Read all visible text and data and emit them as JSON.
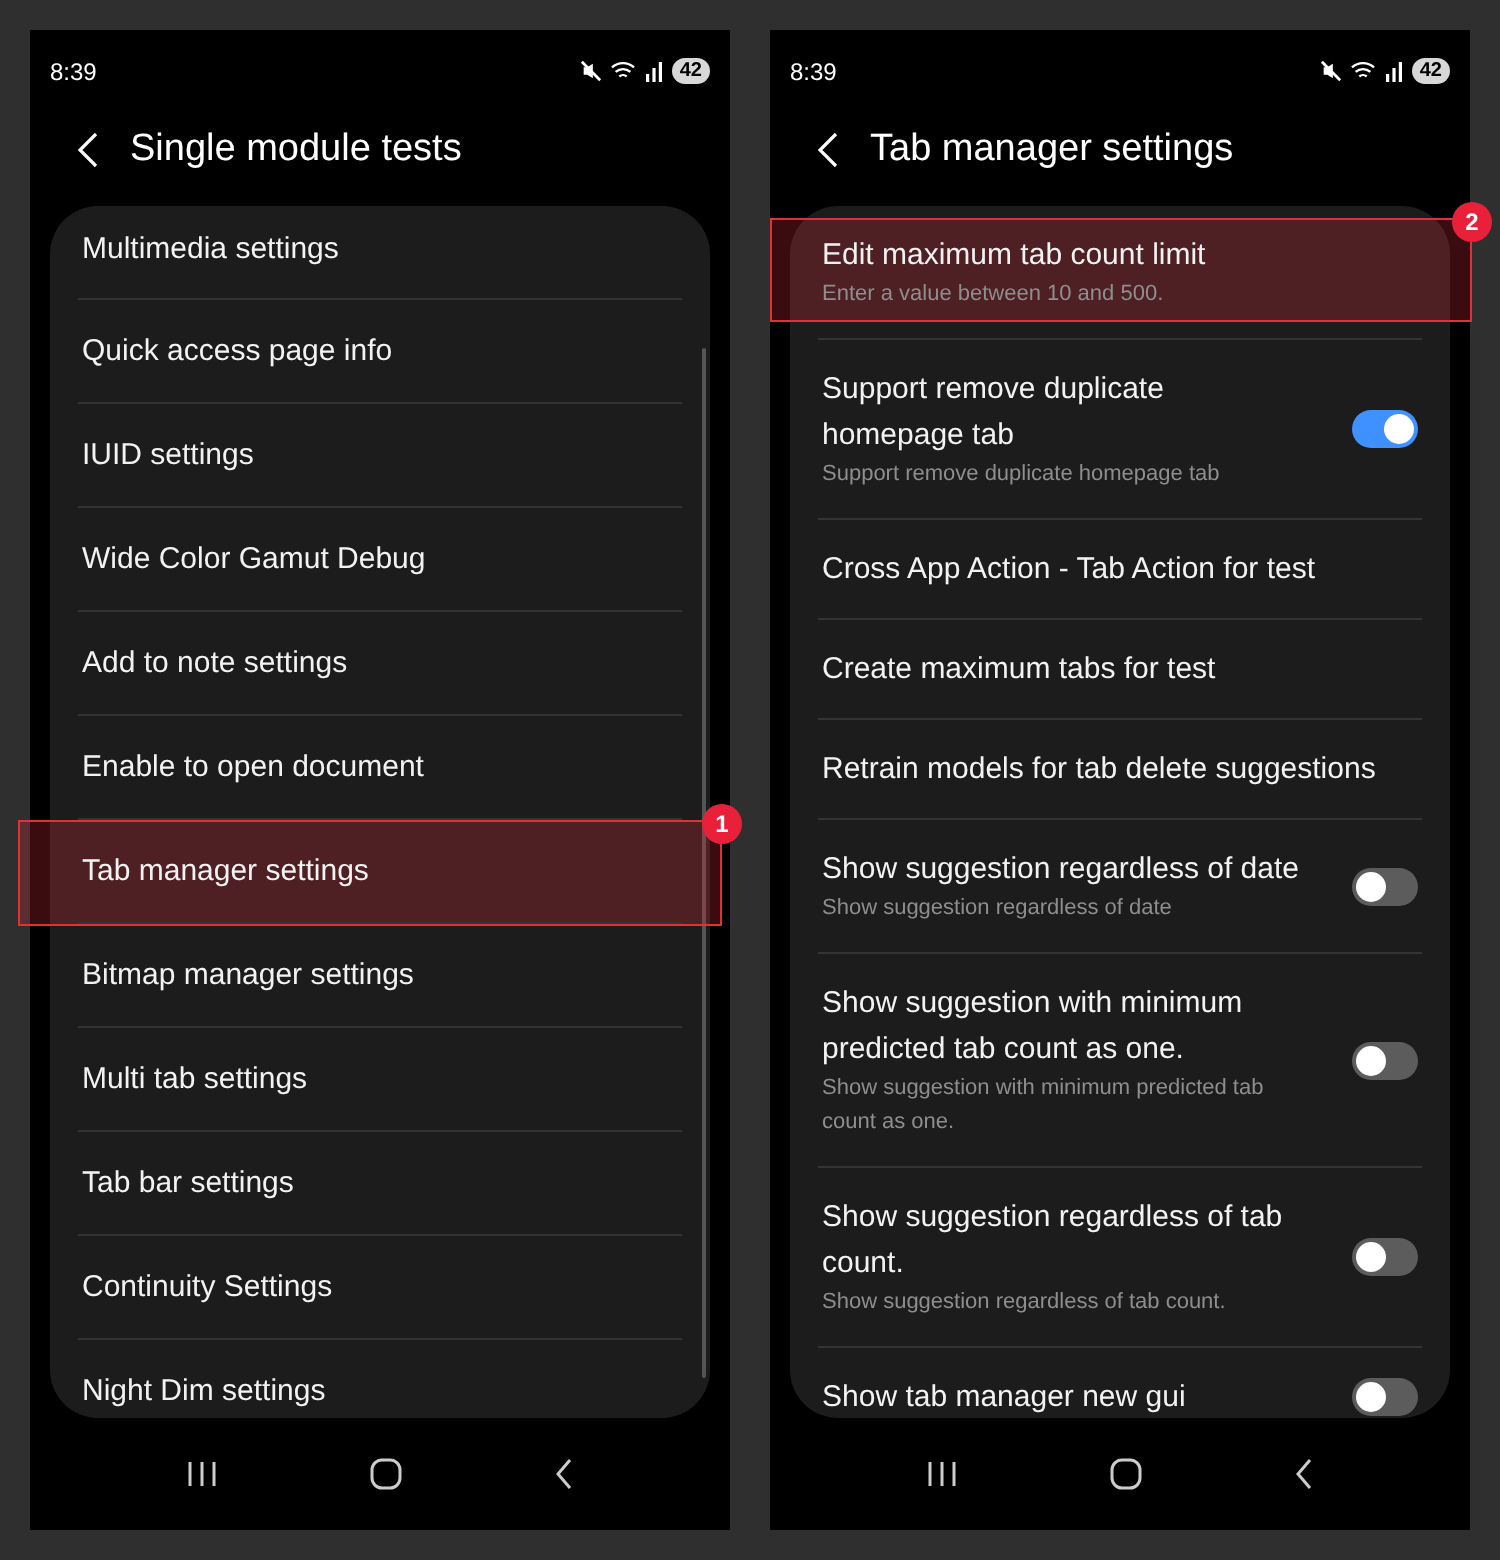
{
  "screens": [
    {
      "status_bar": {
        "time": "8:39",
        "battery": "42"
      },
      "title": "Single module tests",
      "items": [
        {
          "kind": "link",
          "title": "Multimedia settings",
          "highlighted": false
        },
        {
          "kind": "link",
          "title": "Quick access page info",
          "highlighted": false
        },
        {
          "kind": "link",
          "title": "IUID settings",
          "highlighted": false
        },
        {
          "kind": "link",
          "title": "Wide Color Gamut Debug",
          "highlighted": false
        },
        {
          "kind": "link",
          "title": "Add to note settings",
          "highlighted": false
        },
        {
          "kind": "link",
          "title": "Enable to open document",
          "highlighted": false
        },
        {
          "kind": "link",
          "title": "Tab manager settings",
          "highlighted": true,
          "badge": "1"
        },
        {
          "kind": "link",
          "title": "Bitmap manager settings",
          "highlighted": false
        },
        {
          "kind": "link",
          "title": "Multi tab settings",
          "highlighted": false
        },
        {
          "kind": "link",
          "title": "Tab bar settings",
          "highlighted": false
        },
        {
          "kind": "link",
          "title": "Continuity Settings",
          "highlighted": false
        },
        {
          "kind": "link",
          "title": "Night Dim settings",
          "highlighted": false
        }
      ]
    },
    {
      "status_bar": {
        "time": "8:39",
        "battery": "42"
      },
      "title": "Tab manager settings",
      "items": [
        {
          "kind": "link",
          "title": "Edit maximum tab count limit",
          "subtitle": "Enter a value between 10 and 500.",
          "highlighted": true,
          "badge": "2"
        },
        {
          "kind": "toggle",
          "title": "Support remove duplicate homepage tab",
          "subtitle": "Support remove duplicate homepage tab",
          "on": true,
          "highlighted": false
        },
        {
          "kind": "link",
          "title": "Cross App Action - Tab Action for test",
          "highlighted": false
        },
        {
          "kind": "link",
          "title": "Create maximum tabs for test",
          "highlighted": false
        },
        {
          "kind": "link",
          "title": "Retrain models for tab delete suggestions",
          "highlighted": false
        },
        {
          "kind": "toggle",
          "title": "Show suggestion regardless of date",
          "subtitle": "Show suggestion regardless of date",
          "on": false,
          "highlighted": false
        },
        {
          "kind": "toggle",
          "title": "Show suggestion with minimum predicted tab count as one.",
          "subtitle": "Show suggestion with minimum predicted tab count as one.",
          "on": false,
          "highlighted": false
        },
        {
          "kind": "toggle",
          "title": "Show suggestion regardless of tab count.",
          "subtitle": "Show suggestion regardless of tab count.",
          "on": false,
          "highlighted": false
        },
        {
          "kind": "toggle",
          "title": "Show tab manager new gui",
          "on": false,
          "highlighted": false
        }
      ]
    }
  ]
}
